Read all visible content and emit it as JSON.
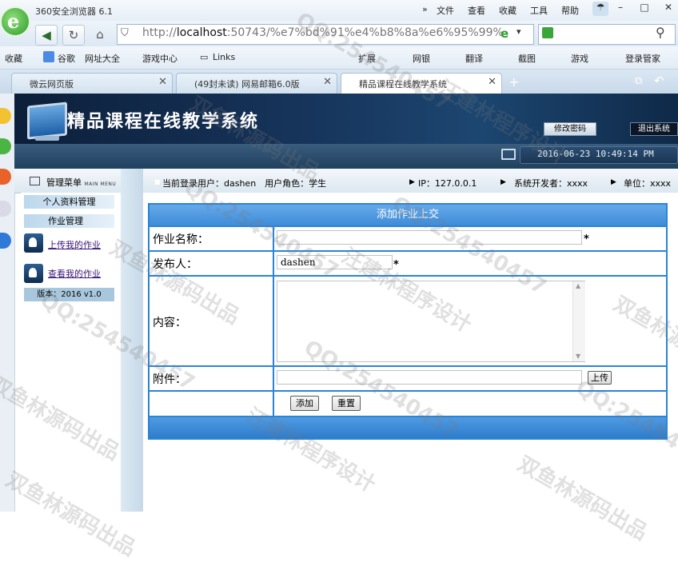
{
  "browser": {
    "title": "360安全浏览器 6.1",
    "menus": [
      "文件",
      "查看",
      "收藏",
      "工具",
      "帮助"
    ],
    "address_host": "localhost",
    "address_rest": ":50743/%e7%bd%91%e4%b8%8a%e6%95%99%",
    "address_scheme": "http://",
    "bookmarks": [
      "收藏",
      "谷歌",
      "网址大全",
      "游戏中心",
      "Links",
      "扩展",
      "网银",
      "翻译",
      "截图",
      "游戏",
      "登录管家"
    ],
    "tabs": [
      {
        "label": "微云网页版"
      },
      {
        "label": "(49封未读) 网易邮箱6.0版"
      },
      {
        "label": "精品课程在线教学系统"
      }
    ]
  },
  "header": {
    "system_title": "精品课程在线教学系统",
    "change_password": "修改密码",
    "logout": "退出系统",
    "datetime": "2016-06-23 10:49:14 PM"
  },
  "infobar": {
    "menu_title": "管理菜单",
    "menu_sub": "MAIN MENU",
    "current_user": "当前登录用户：dashen　用户角色：学生",
    "ip": "IP：127.0.0.1",
    "developer": "系统开发者：xxxx",
    "unit": "单位：xxxx"
  },
  "menu": {
    "section_profile": "个人资料管理",
    "section_homework": "作业管理",
    "link_upload": "上传我的作业",
    "link_view": "查看我的作业",
    "version": "版本：2016 v1.0"
  },
  "form": {
    "title": "添加作业上交",
    "name_label": "作业名称：",
    "name_value": "",
    "publisher_label": "发布人：",
    "publisher_value": "dashen",
    "content_label": "内容：",
    "attachment_label": "附件：",
    "upload_button": "上传",
    "add_button": "添加",
    "reset_button": "重置",
    "required_mark": "*"
  },
  "watermarks": [
    "QQ:254540457",
    "汪建林程序设计",
    "双鱼林源码出品"
  ]
}
